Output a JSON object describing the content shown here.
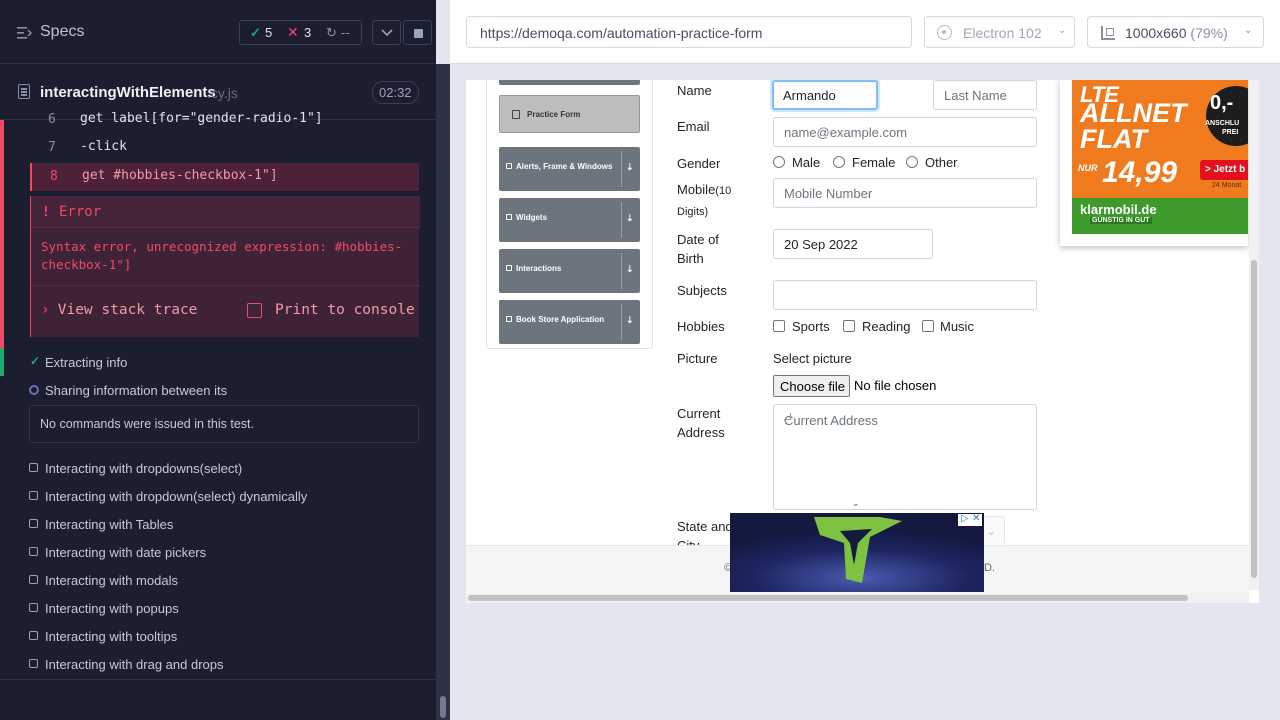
{
  "reporter": {
    "header_title": "Specs",
    "stats": {
      "passed": "5",
      "failed": "3",
      "pending": "--"
    },
    "spec_file": {
      "name": "interactingWithElements",
      "ext": ".cy.js",
      "duration": "02:32"
    },
    "commands": [
      {
        "num": "6",
        "text": "get  label[for=\"gender-radio-1\"]"
      },
      {
        "num": "7",
        "text": "-click"
      },
      {
        "num": "8",
        "text": "get  #hobbies-checkbox-1\"]"
      }
    ],
    "error": {
      "title": "Error",
      "message": "Syntax error, unrecognized expression: #hobbies-checkbox-1\"]",
      "stack_label": "View stack trace",
      "print_label": "Print to console"
    },
    "tests": {
      "extracting": "Extracting info",
      "sharing": "Sharing information between its",
      "no_commands": "No commands were issued in this test.",
      "pending": [
        "Interacting with dropdowns(select)",
        "Interacting with dropdown(select) dynamically",
        "Interacting with Tables",
        "Interacting with date pickers",
        "Interacting with modals",
        "Interacting with popups",
        "Interacting with tooltips",
        "Interacting with drag and drops"
      ]
    }
  },
  "aut_header": {
    "url": "https://demoqa.com/automation-practice-form",
    "browser": "Electron 102",
    "viewport": "1000x660",
    "scale": "(79%)"
  },
  "page": {
    "menu": {
      "practice_form": "Practice Form",
      "items": [
        "Alerts, Frame & Windows",
        "Widgets",
        "Interactions",
        "Book Store Application"
      ]
    },
    "form": {
      "name_label": "Name",
      "first_name_value": "Armando",
      "last_name_placeholder": "Last Name",
      "email_label": "Email",
      "email_placeholder": "name@example.com",
      "gender_label": "Gender",
      "genders": [
        "Male",
        "Female",
        "Other"
      ],
      "mobile_label": "Mobile",
      "mobile_sub": "(10 Digits)",
      "mobile_placeholder": "Mobile Number",
      "dob_label": "Date of Birth",
      "dob_value": "20 Sep 2022",
      "subjects_label": "Subjects",
      "hobbies_label": "Hobbies",
      "hobbies": [
        "Sports",
        "Reading",
        "Music"
      ],
      "picture_label": "Picture",
      "select_picture": "Select picture",
      "choose_file": "Choose file",
      "no_file": "No file chosen",
      "address_label": "Current Address",
      "address_placeholder": "Current Address",
      "state_label": "State and City"
    },
    "footer_text": "©",
    "footer_text_end": "D.",
    "ad_top": {
      "line1": "LTE",
      "line2": "ALLNET",
      "line3": "FLAT",
      "nur": "NUR",
      "price": "14,99",
      "circle_big": "0,-",
      "circle_small1": "ANSCHLU",
      "circle_small2": "PREI",
      "cta": "> Jetzt b",
      "monat": "24 Monat",
      "brand": "klarmobil.de",
      "brand_sub": "GÜNSTIG IN GUT"
    },
    "ad_bottom": {
      "info": "▷",
      "close": "✕"
    }
  }
}
